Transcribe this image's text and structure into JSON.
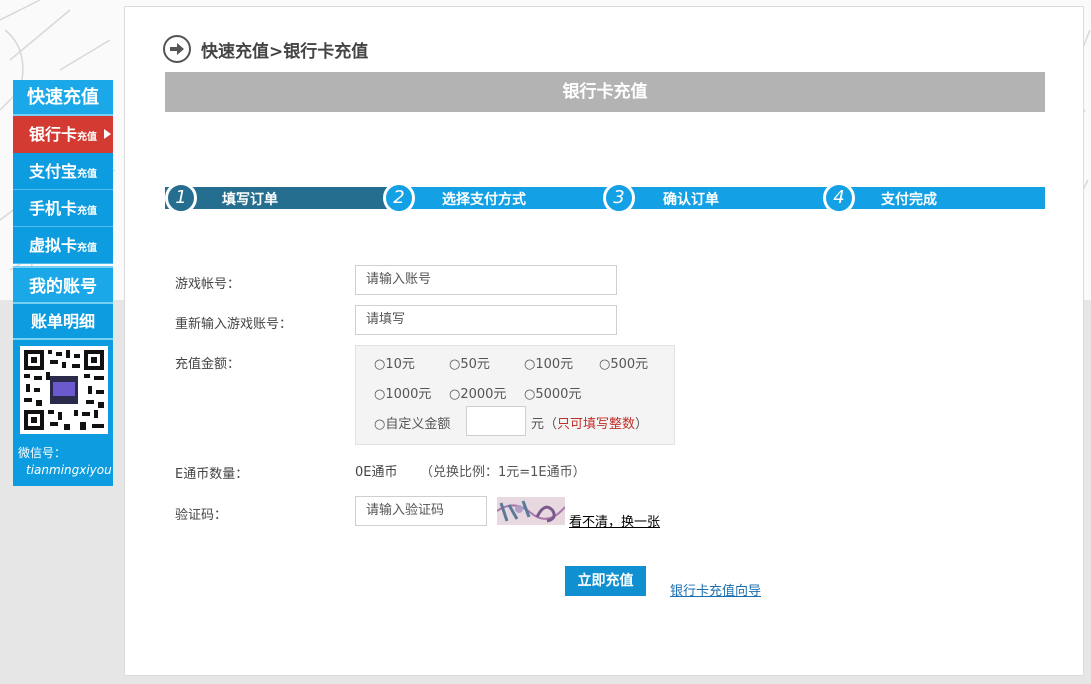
{
  "breadcrumb": "快速充值>银行卡充值",
  "banner_title": "银行卡充值",
  "sidebar": {
    "title": "快速充值",
    "items": [
      {
        "main": "银行卡",
        "sub": "充值"
      },
      {
        "main": "支付宝",
        "sub": "充值"
      },
      {
        "main": "手机卡",
        "sub": "充值"
      },
      {
        "main": "虚拟卡",
        "sub": "充值"
      }
    ],
    "account_title": "我的账号",
    "account_item": "账单明细",
    "wechat_label": "微信号：",
    "wechat_id": "tianmingxiyou"
  },
  "steps": [
    {
      "num": "1",
      "label": "填写订单"
    },
    {
      "num": "2",
      "label": "选择支付方式"
    },
    {
      "num": "3",
      "label": "确认订单"
    },
    {
      "num": "4",
      "label": "支付完成"
    }
  ],
  "form": {
    "account_label": "游戏帐号：",
    "account_placeholder": "请输入账号",
    "reaccount_label": "重新输入游戏账号：",
    "reaccount_placeholder": "请填写",
    "amount_label": "充值金额：",
    "amounts": [
      "10元",
      "50元",
      "100元",
      "500元",
      "1000元",
      "2000元",
      "5000元"
    ],
    "custom_label": "自定义金额",
    "custom_unit": "元（",
    "custom_hint": "只可填写整数",
    "custom_close": "）",
    "coin_label": "E通币数量：",
    "coin_value": "0E通币",
    "coin_ratio": "（兑换比例：1元=1E通币）",
    "captcha_label": "验证码：",
    "captcha_placeholder": "请输入验证码",
    "captcha_refresh": "看不清，换一张"
  },
  "submit_label": "立即充值",
  "guide_link": "银行卡充值向导",
  "colors": {
    "accent": "#13a0e4",
    "active_red": "#d33a31",
    "step_done": "#266e8f",
    "banner_gray": "#b3b3b3"
  }
}
